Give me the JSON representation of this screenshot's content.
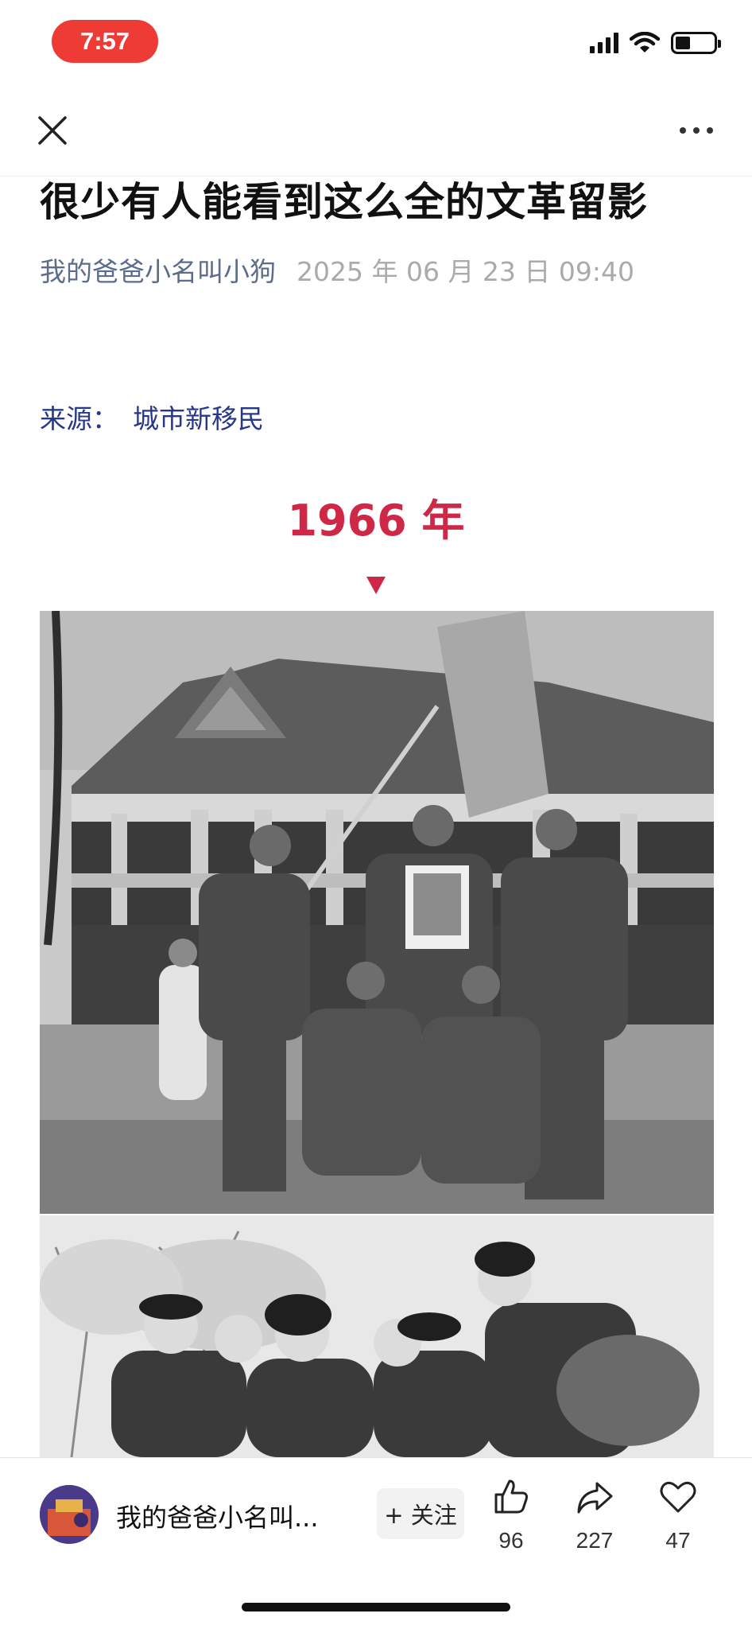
{
  "status_bar": {
    "time": "7:57",
    "time_pill_color": "#ef3b36"
  },
  "article": {
    "title": "很少有人能看到这么全的文革留影",
    "author": "我的爸爸小名叫小狗",
    "datetime": "2025 年 06 月 23 日  09:40",
    "source_label": "来源：",
    "source_name": "城市新移民",
    "year_heading": "1966 年",
    "accent_color": "#cf2746"
  },
  "bottom_bar": {
    "account_name": "我的爸爸小名叫...",
    "follow_label": "+ 关注",
    "like_count": "96",
    "share_count": "227",
    "favorite_count": "47"
  },
  "icons": {
    "close": "close-icon",
    "more": "more-dots-icon",
    "like": "thumbs-up-icon",
    "share": "share-arrow-icon",
    "favorite": "heart-icon"
  }
}
